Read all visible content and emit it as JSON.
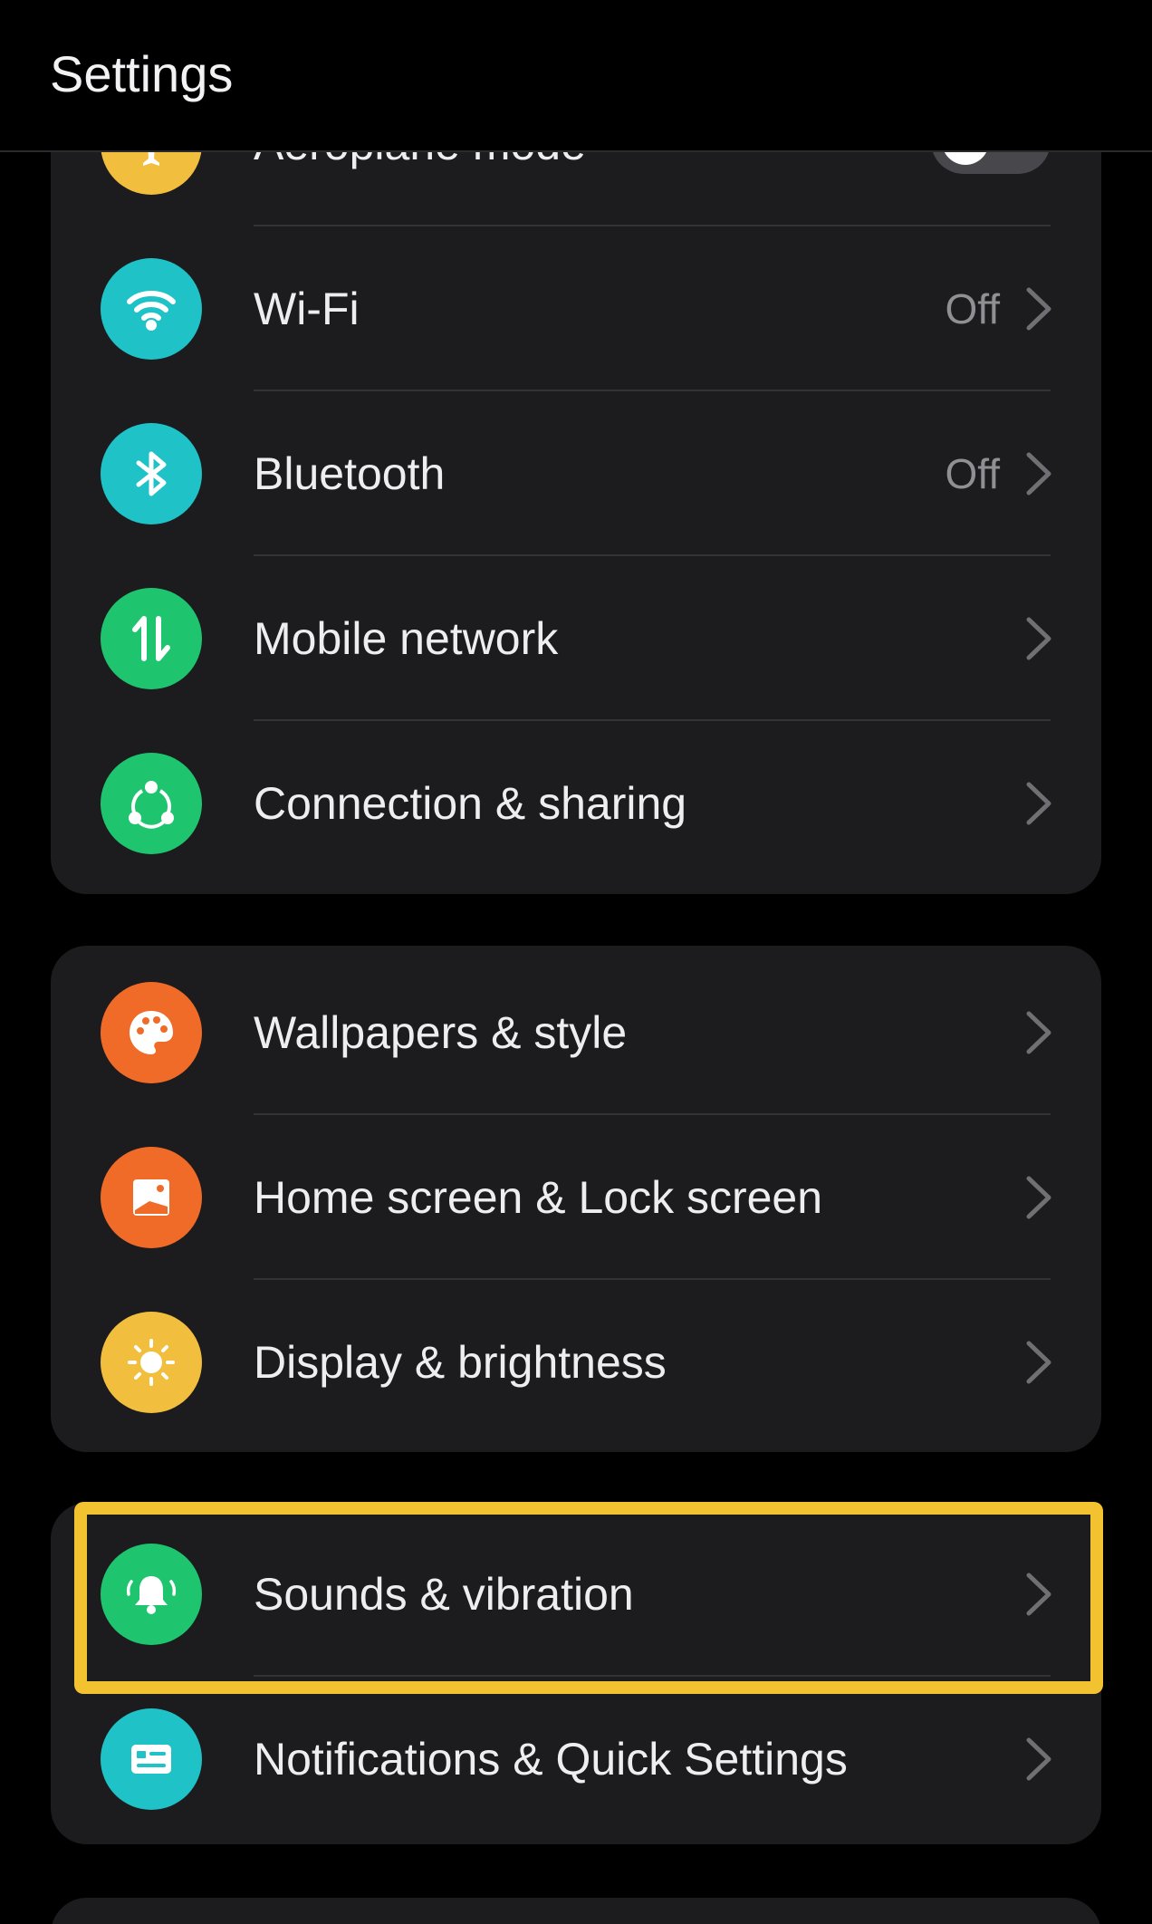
{
  "header": {
    "title": "Settings"
  },
  "colors": {
    "yellow": "#f2be3e",
    "cyan": "#1fc2c6",
    "green": "#1fc46f",
    "orange": "#f06a28",
    "highlight": "#f2c230"
  },
  "groups": [
    {
      "items": [
        {
          "label": "Aeroplane mode",
          "icon": "airplane-icon",
          "toggle": false
        },
        {
          "label": "Wi-Fi",
          "icon": "wifi-icon",
          "value": "Off"
        },
        {
          "label": "Bluetooth",
          "icon": "bluetooth-icon",
          "value": "Off"
        },
        {
          "label": "Mobile network",
          "icon": "mobile-data-icon"
        },
        {
          "label": "Connection & sharing",
          "icon": "share-icon"
        }
      ]
    },
    {
      "items": [
        {
          "label": "Wallpapers & style",
          "icon": "palette-icon"
        },
        {
          "label": "Home screen & Lock screen",
          "icon": "picture-icon"
        },
        {
          "label": "Display & brightness",
          "icon": "sun-icon"
        }
      ]
    },
    {
      "items": [
        {
          "label": "Sounds & vibration",
          "icon": "bell-icon",
          "highlighted": true
        },
        {
          "label": "Notifications & Quick Settings",
          "icon": "notification-icon"
        }
      ]
    }
  ]
}
